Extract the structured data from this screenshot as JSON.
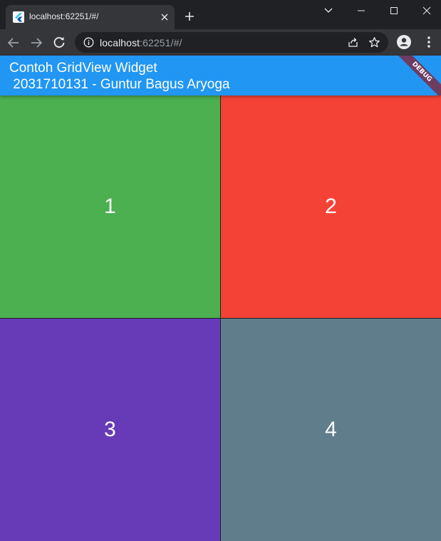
{
  "browser": {
    "tab_title": "localhost:62251/#/",
    "url_host": "localhost",
    "url_rest": ":62251/#/"
  },
  "app": {
    "title_line1": "Contoh GridView Widget",
    "title_line2": " 2031710131 - Guntur Bagus Aryoga",
    "debug_banner": "DEBUG",
    "appbar_color": "#2196f3"
  },
  "grid": {
    "items": [
      {
        "label": "1",
        "color": "#4caf50"
      },
      {
        "label": "2",
        "color": "#f44336"
      },
      {
        "label": "3",
        "color": "#673ab7"
      },
      {
        "label": "4",
        "color": "#607d8b"
      }
    ]
  }
}
